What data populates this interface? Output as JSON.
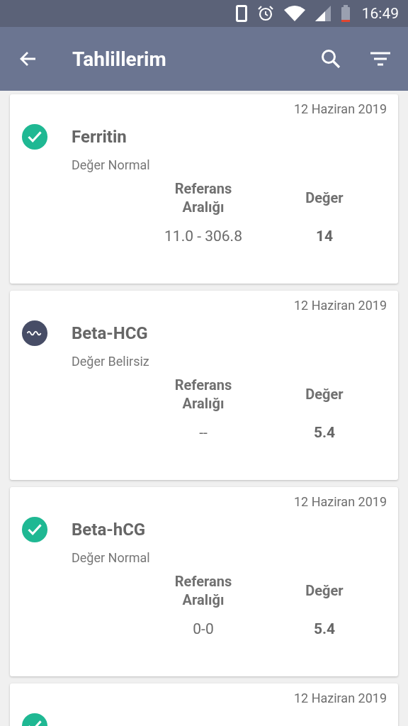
{
  "status_bar": {
    "time": "16:49"
  },
  "app_bar": {
    "title": "Tahlillerim"
  },
  "results": [
    {
      "date": "12 Haziran 2019",
      "name": "Ferritin",
      "kind": "normal",
      "status_text": "Değer Normal",
      "range_label": "Referans Aralığı",
      "value_label": "Değer",
      "range": "11.0 - 306.8",
      "value": "14"
    },
    {
      "date": "12 Haziran 2019",
      "name": "Beta-HCG",
      "kind": "uncertain",
      "status_text": "Değer Belirsiz",
      "range_label": "Referans Aralığı",
      "value_label": "Değer",
      "range": "--",
      "value": "5.4"
    },
    {
      "date": "12 Haziran 2019",
      "name": "Beta-hCG",
      "kind": "normal",
      "status_text": "Değer Normal",
      "range_label": "Referans Aralığı",
      "value_label": "Değer",
      "range": "0-0",
      "value": "5.4"
    },
    {
      "date": "12 Haziran 2019",
      "kind": "normal"
    }
  ]
}
